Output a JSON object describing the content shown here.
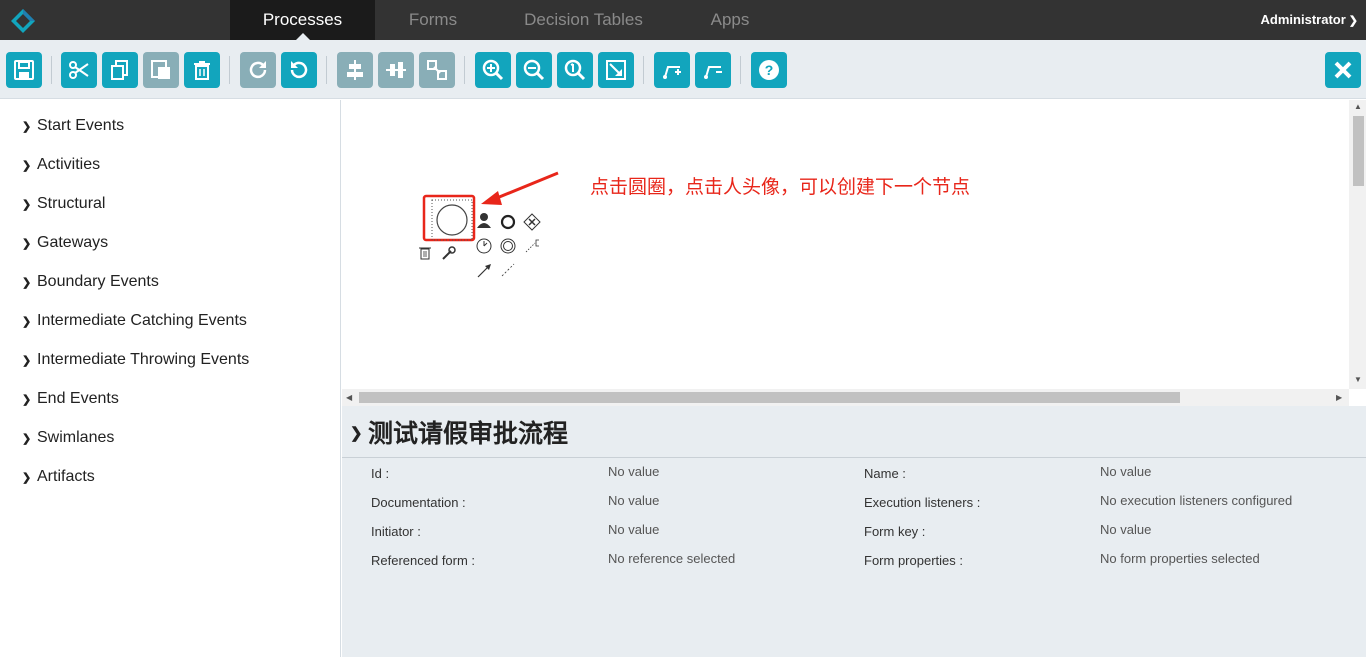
{
  "nav": {
    "tabs": [
      "Processes",
      "Forms",
      "Decision Tables",
      "Apps"
    ],
    "active_tab": "Processes",
    "user": "Administrator"
  },
  "toolbar": {
    "groups": [
      [
        "save"
      ],
      [
        "cut",
        "copy",
        "paste",
        "delete"
      ],
      [
        "redo",
        "undo"
      ],
      [
        "align-horizontal",
        "align-vertical",
        "same-size"
      ],
      [
        "zoom-in",
        "zoom-out",
        "zoom-actual",
        "zoom-fit"
      ],
      [
        "add-bendpoint",
        "remove-bendpoint"
      ],
      [
        "help"
      ]
    ],
    "close": "close"
  },
  "palette": {
    "items": [
      "Start Events",
      "Activities",
      "Structural",
      "Gateways",
      "Boundary Events",
      "Intermediate Catching Events",
      "Intermediate Throwing Events",
      "End Events",
      "Swimlanes",
      "Artifacts"
    ]
  },
  "canvas": {
    "annotation": "点击圆圈，点击人头像，可以创建下一个节点"
  },
  "properties": {
    "title": "测试请假审批流程",
    "rows": [
      {
        "label": "Id :",
        "value": "No value",
        "label2": "Name :",
        "value2": "No value"
      },
      {
        "label": "Documentation :",
        "value": "No value",
        "label2": "Execution listeners :",
        "value2": "No execution listeners configured"
      },
      {
        "label": "Initiator :",
        "value": "No value",
        "label2": "Form key :",
        "value2": "No value"
      },
      {
        "label": "Referenced form :",
        "value": "No reference selected",
        "label2": "Form properties :",
        "value2": "No form properties selected"
      }
    ]
  },
  "colors": {
    "accent": "#12a5bd",
    "disabled": "#89aeb7",
    "topbar": "#333333",
    "annotation": "#e8261a"
  }
}
